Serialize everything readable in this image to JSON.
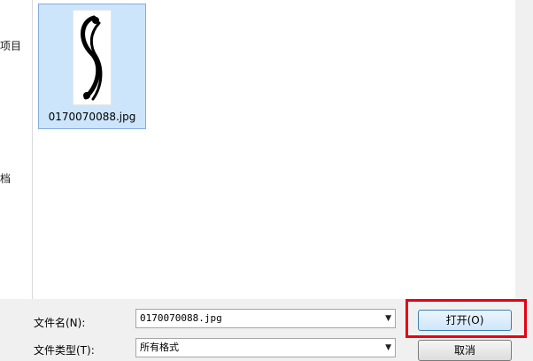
{
  "nav": {
    "items": [
      {
        "label": "项目"
      },
      {
        "label": "档"
      }
    ]
  },
  "files": [
    {
      "name": "0170070088.jpg",
      "thumbnail_icon": "swirl-ornament-icon",
      "selected": true
    }
  ],
  "filename_field": {
    "label": "文件名(N):",
    "value": "0170070088.jpg"
  },
  "filetype_field": {
    "label": "文件类型(T):",
    "value": "所有格式"
  },
  "buttons": {
    "open": "打开(O)",
    "cancel": "取消"
  },
  "colors": {
    "selection": "#cce5fb",
    "highlight": "#e60012"
  }
}
